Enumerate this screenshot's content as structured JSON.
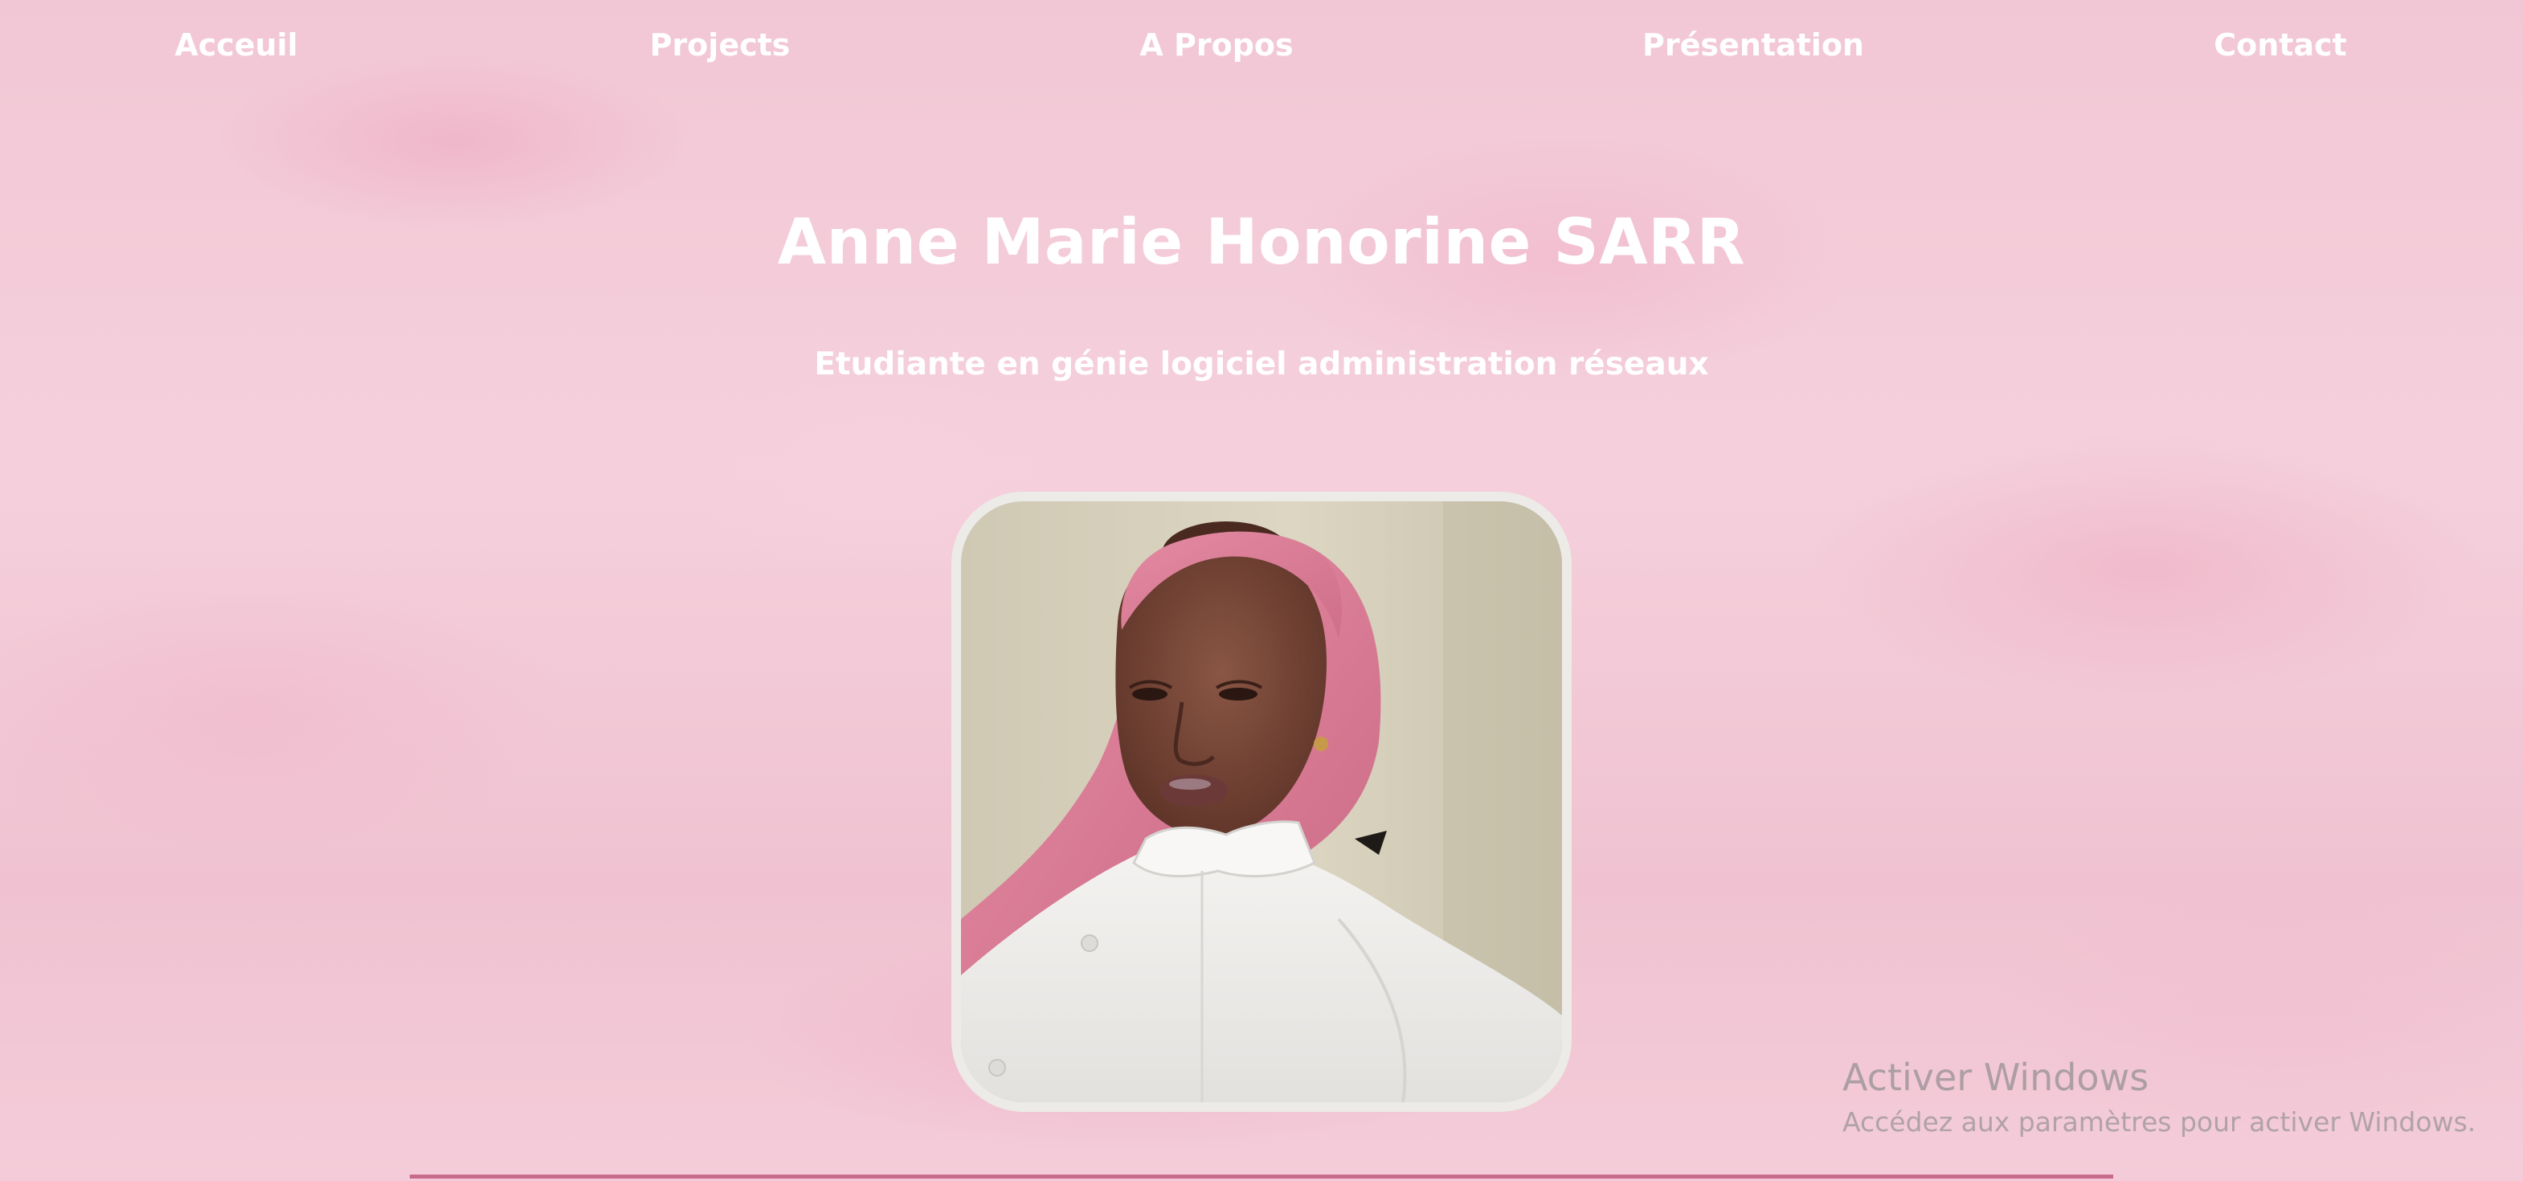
{
  "nav": {
    "items": [
      {
        "label": "Acceuil"
      },
      {
        "label": "Projects"
      },
      {
        "label": "A Propos"
      },
      {
        "label": "Présentation"
      },
      {
        "label": "Contact"
      }
    ]
  },
  "hero": {
    "name": "Anne Marie Honorine SARR",
    "subtitle": "Etudiante en génie logiciel administration réseaux"
  },
  "windows_watermark": {
    "title": "Activer Windows",
    "subtitle": "Accédez aux paramètres pour activer Windows."
  },
  "colors": {
    "background": "#f3c9d6",
    "text": "#ffffff",
    "accent_rule": "#c76a8c",
    "photo_border": "#ecebe7"
  }
}
